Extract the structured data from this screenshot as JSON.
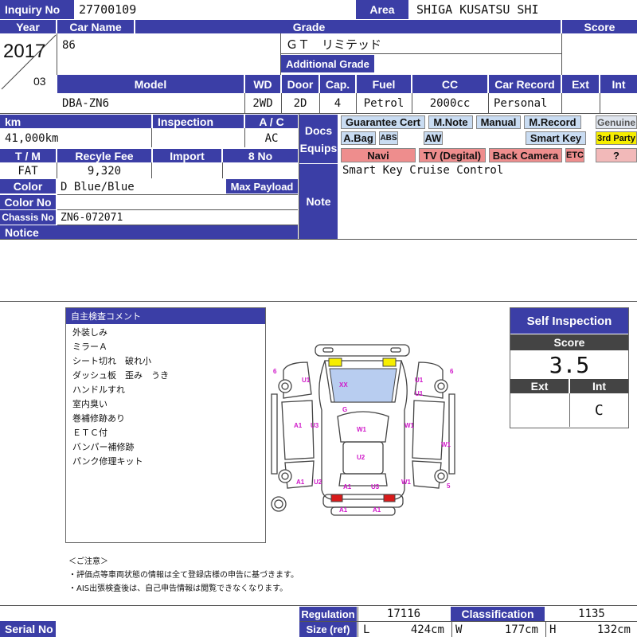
{
  "header": {
    "inquiry_label": "Inquiry No",
    "inquiry_value": "27700109",
    "area_label": "Area",
    "area_value": "SHIGA KUSATSU SHI",
    "year_label": "Year",
    "year_value": "2017",
    "month_value": "03",
    "carname_label": "Car Name",
    "carname_value": "86",
    "grade_label": "Grade",
    "grade_value": "ＧＴ　リミテッド",
    "additional_grade_label": "Additional Grade",
    "score_label": "Score"
  },
  "model_row": {
    "model_label": "Model",
    "model_value": "DBA-ZN6",
    "wd_label": "WD",
    "wd_value": "2WD",
    "door_label": "Door",
    "door_value": "2D",
    "cap_label": "Cap.",
    "cap_value": "4",
    "fuel_label": "Fuel",
    "fuel_value": "Petrol",
    "cc_label": "CC",
    "cc_value": "2000cc",
    "record_label": "Car Record",
    "record_value": "Personal",
    "ext_label": "Ext",
    "int_label": "Int"
  },
  "details": {
    "km_label": "km",
    "km_value": "41,000km",
    "inspection_label": "Inspection",
    "ac_label": "A / C",
    "ac_value": "AC",
    "tm_label": "T / M",
    "tm_value": "FAT",
    "recycle_label": "Recyle Fee",
    "recycle_value": "9,320",
    "import_label": "Import",
    "eightno_label": "8 No",
    "color_label": "Color",
    "color_value": "D Blue/Blue",
    "payload_label": "Max Payload",
    "colorno_label": "Color No",
    "chassis_label": "Chassis No",
    "chassis_value": "ZN6-072071",
    "notice_label": "Notice"
  },
  "docs": {
    "label_line1": "Docs",
    "label_line2": "Equips",
    "chips": {
      "guarantee": "Guarantee Cert",
      "mnote": "M.Note",
      "manual": "Manual",
      "mrecord": "M.Record",
      "genuine": "Genuine",
      "abag": "A.Bag",
      "abs": "ABS",
      "aw": "AW",
      "smartkey": "Smart Key",
      "third": "3rd Party",
      "navi": "Navi",
      "tv": "TV (Degital)",
      "backcam": "Back Camera",
      "etc": "ETC",
      "q": "?"
    }
  },
  "note": {
    "label": "Note",
    "value": "Smart Key Cruise Control"
  },
  "inspection_comments": {
    "title": "自主検査コメント",
    "lines": [
      "外装しみ",
      "ミラーＡ",
      "シート切れ　破れ小",
      "ダッシュ板　歪み　うき",
      "ハンドルすれ",
      "室内臭い",
      "巻補修跡あり",
      "ＥＴＣ付",
      "バンパー補修跡",
      "パンク修理キット"
    ]
  },
  "diagram_marks": {
    "xx": "XX",
    "g": "G",
    "u1": "U1",
    "a1": "A1",
    "u3": "U3",
    "w1": "W1",
    "u2": "U2",
    "six": "6",
    "five": "5"
  },
  "self_inspection": {
    "title": "Self Inspection",
    "score_label": "Score",
    "score_value": "3.5",
    "ext_label": "Ext",
    "int_label": "Int",
    "ext_value": "",
    "int_value": "C"
  },
  "caution": {
    "title": "＜ご注意＞",
    "line1": "・評価点等車両状態の情報は全て登録店様の申告に基づきます。",
    "line2": "・AIS出張検査後は、自己申告情報は閲覧できなくなります。"
  },
  "footer": {
    "serial_label": "Serial No",
    "regulation_label": "Regulation",
    "regulation_value": "17116",
    "classification_label": "Classification",
    "classification_value": "1135",
    "size_label": "Size (ref)",
    "l_label": "L",
    "l_value": "424cm",
    "w_label": "W",
    "w_value": "177cm",
    "h_label": "H",
    "h_value": "132cm"
  },
  "colors": {
    "header_bg": "#3b3ea6",
    "chip_blue": "#c9dcf2",
    "chip_red": "#ee8d8d",
    "chip_yellow": "#f6ee00",
    "mark": "#d017c9"
  }
}
